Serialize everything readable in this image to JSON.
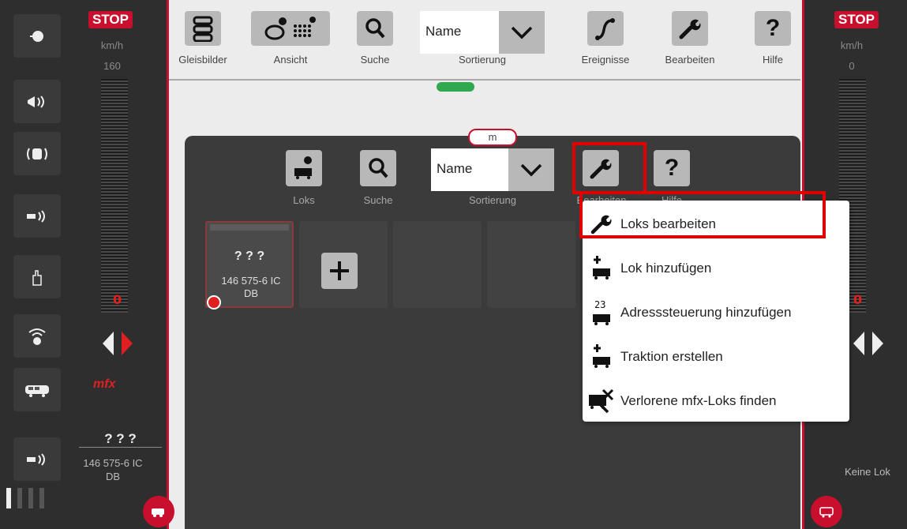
{
  "left_panel": {
    "stop": "STOP",
    "unit": "km/h",
    "max_speed": "160",
    "speed": "0",
    "loco_name": "? ? ?",
    "loco_desc": "146 575-6 IC DB",
    "mfx": "mfx",
    "function_icons": [
      "headlight-icon",
      "horn-icon",
      "radio-cab-icon",
      "horn2-icon",
      "hand-icon",
      "wifi-sound-icon",
      "railcar-icon",
      "horn3-icon"
    ]
  },
  "right_panel": {
    "stop": "STOP",
    "unit": "km/h",
    "speed_value": "0",
    "speed": "0",
    "no_loco": "Keine Lok"
  },
  "toolbar": {
    "gleisbilder": "Gleisbilder",
    "ansicht": "Ansicht",
    "suche": "Suche",
    "sort_value": "Name",
    "sortierung": "Sortierung",
    "ereignisse": "Ereignisse",
    "bearbeiten": "Bearbeiten",
    "hilfe": "Hilfe"
  },
  "main": {
    "tab_label": "m",
    "loks": "Loks",
    "suche": "Suche",
    "sort_value": "Name",
    "sortierung": "Sortierung",
    "bearbeiten": "Bearbeiten",
    "hilfe": "Hilfe",
    "loco_card": {
      "name": "? ? ?",
      "desc": "146 575-6 IC DB"
    }
  },
  "menu": {
    "items": [
      "Loks bearbeiten",
      "Lok hinzufügen",
      "Adresssteuerung hinzufügen",
      "Traktion erstellen",
      "Verlorene mfx-Loks finden"
    ]
  },
  "colors": {
    "accent": "#c8102e",
    "highlight": "#e00000",
    "status_green": "#2fa84f"
  }
}
